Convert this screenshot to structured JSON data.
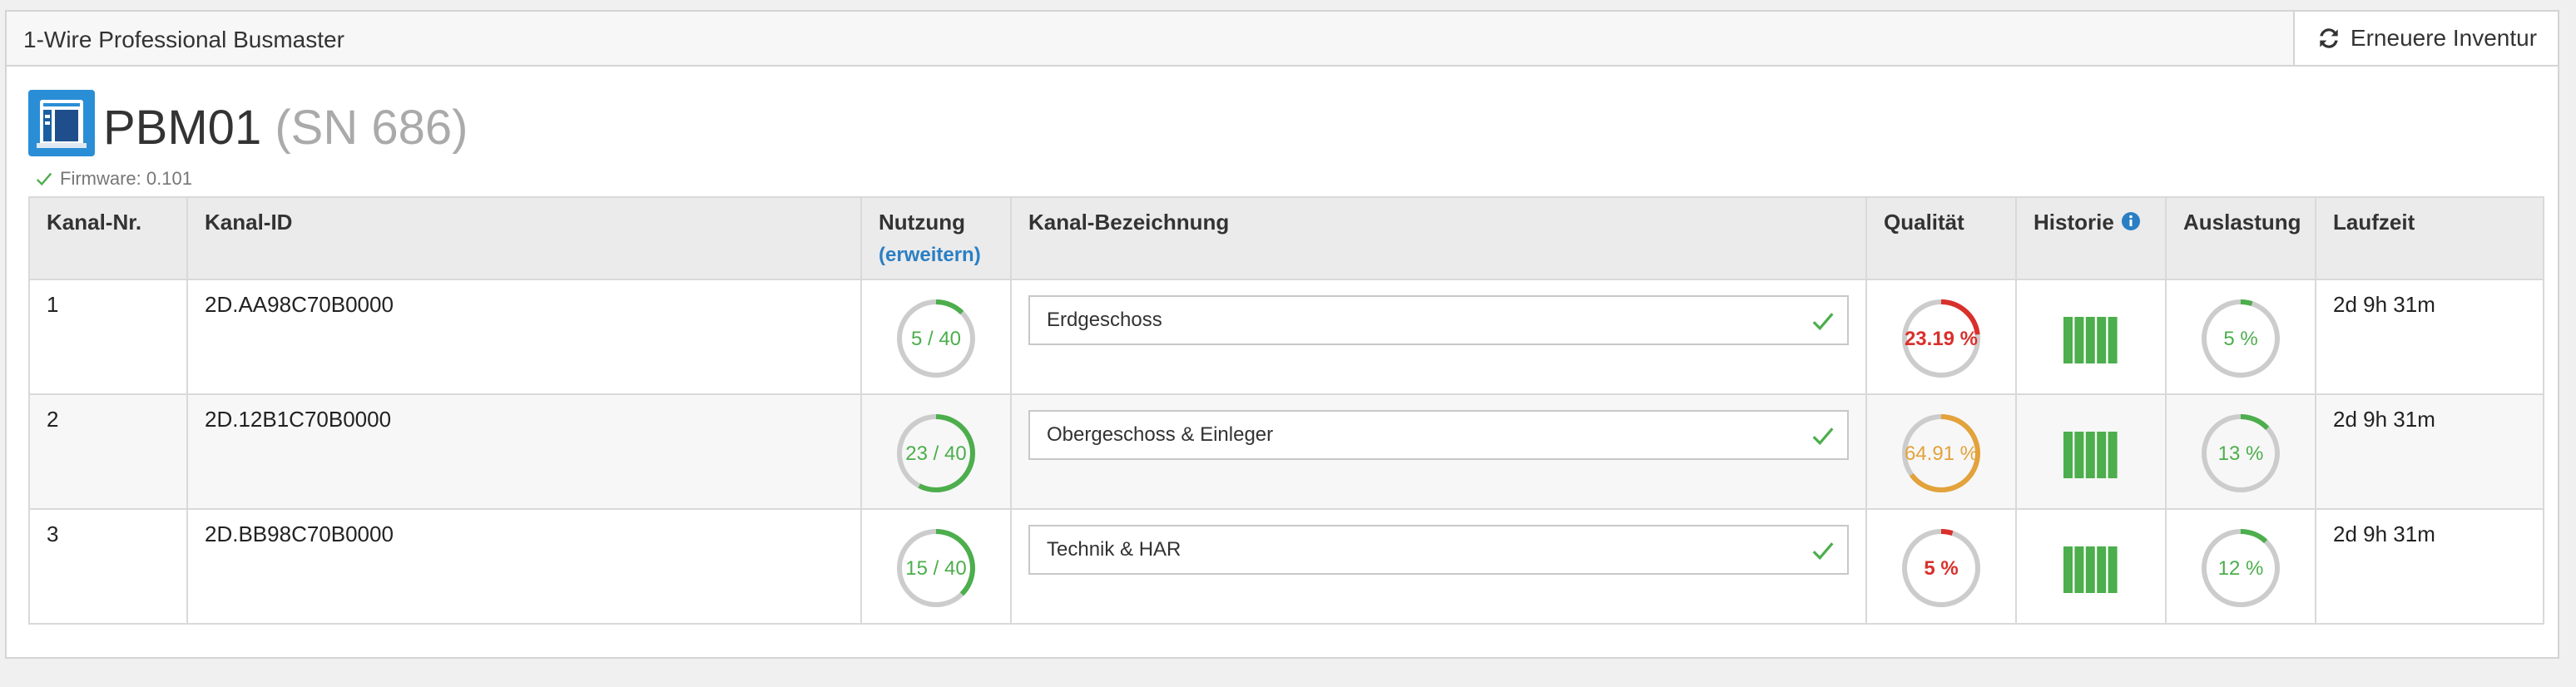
{
  "panel": {
    "title": "1-Wire Professional Busmaster",
    "refresh_button": "Erneuere Inventur"
  },
  "device": {
    "name": "PBM01",
    "serial": "(SN 686)",
    "firmware": "Firmware: 0.101"
  },
  "table": {
    "headers": {
      "channel_no": "Kanal-Nr.",
      "channel_id": "Kanal-ID",
      "usage": "Nutzung",
      "usage_expand": "(erweitern)",
      "label": "Kanal-Bezeichnung",
      "quality": "Qualität",
      "history": "Historie",
      "load": "Auslastung",
      "runtime": "Laufzeit"
    },
    "rows": [
      {
        "no": "1",
        "id": "2D.AA98C70B0000",
        "usage_text": "5 / 40",
        "usage_fraction": 0.125,
        "label": "Erdgeschoss",
        "quality_text": "23.19 %",
        "quality_fraction": 0.2319,
        "quality_color": "#d9302c",
        "load_text": "5 %",
        "load_fraction": 0.05,
        "runtime": "2d 9h 31m"
      },
      {
        "no": "2",
        "id": "2D.12B1C70B0000",
        "usage_text": "23 / 40",
        "usage_fraction": 0.575,
        "label": "Obergeschoss & Einleger",
        "quality_text": "64.91 %",
        "quality_fraction": 0.6491,
        "quality_color": "#e3a23a",
        "load_text": "13 %",
        "load_fraction": 0.13,
        "runtime": "2d 9h 31m"
      },
      {
        "no": "3",
        "id": "2D.BB98C70B0000",
        "usage_text": "15 / 40",
        "usage_fraction": 0.375,
        "label": "Technik & HAR",
        "quality_text": "5 %",
        "quality_fraction": 0.05,
        "quality_color": "#d9302c",
        "load_text": "12 %",
        "load_fraction": 0.12,
        "runtime": "2d 9h 31m"
      }
    ]
  },
  "colors": {
    "accent": "#2a8ed6",
    "ok_green": "#4cae4c",
    "ring_track": "#cccccc"
  },
  "icons": {
    "refresh": "refresh-icon",
    "device": "busmaster-device-icon",
    "check": "check-icon",
    "info": "info-icon",
    "history": "history-bars-icon"
  }
}
